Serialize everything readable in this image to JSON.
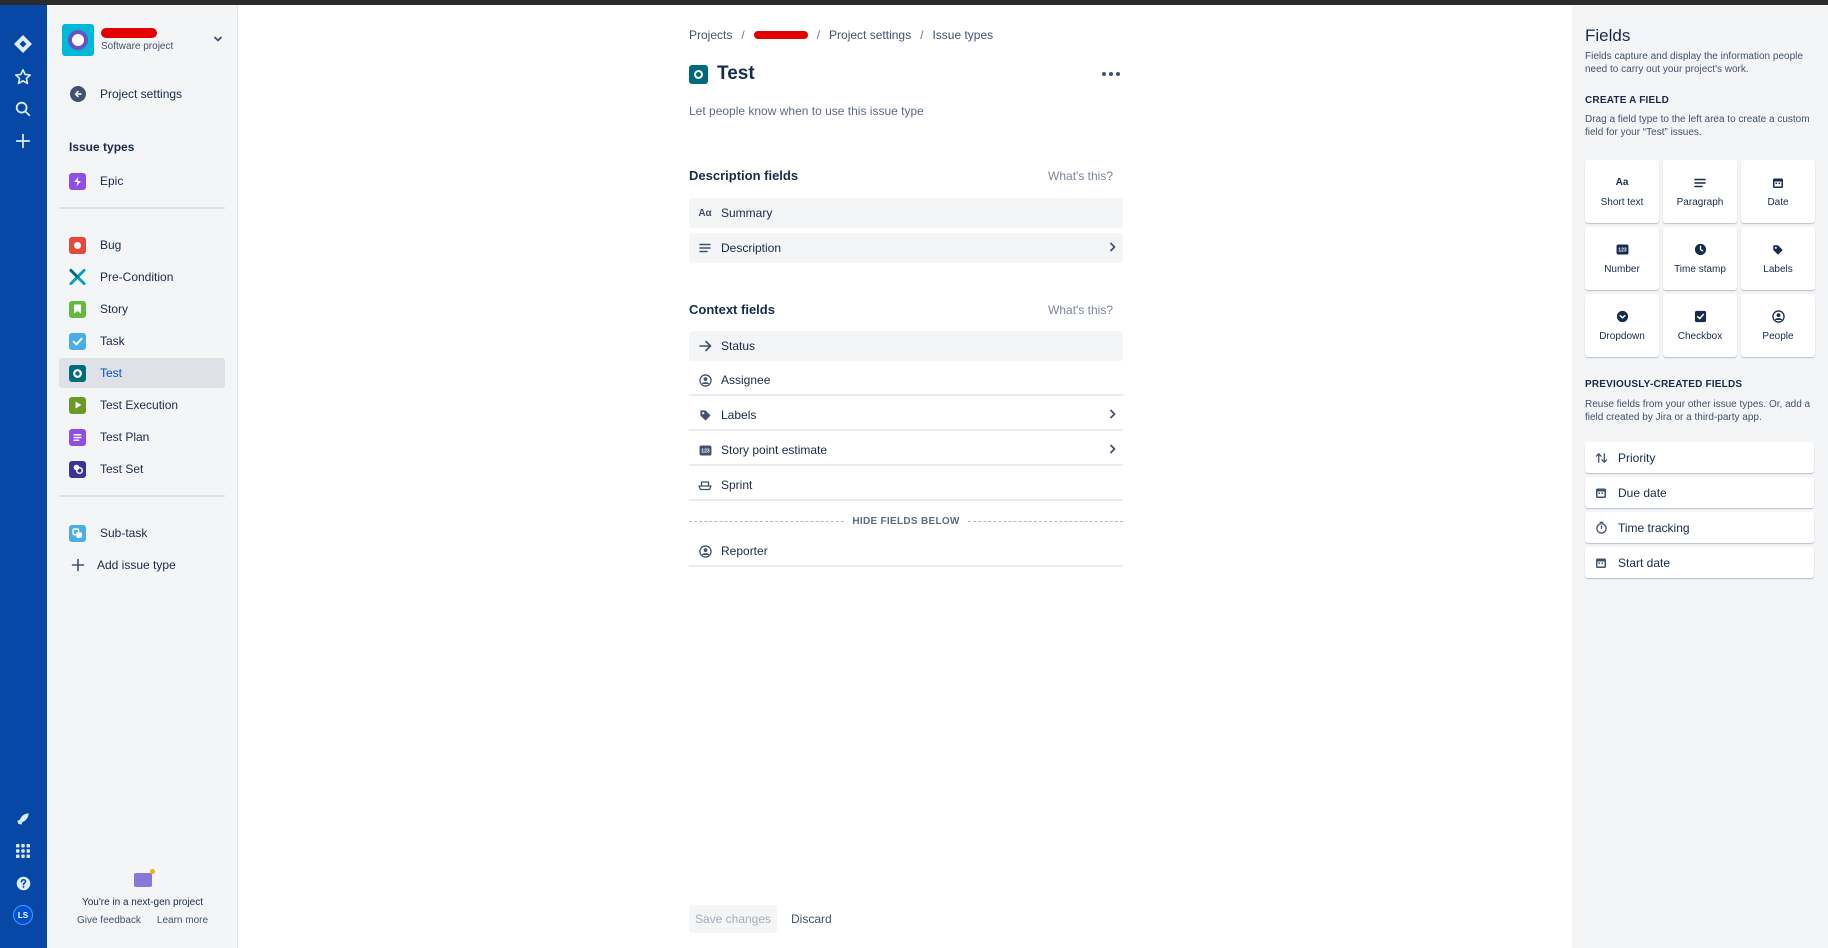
{
  "project": {
    "type_label": "Software project"
  },
  "sidebar": {
    "back_label": "Project settings",
    "section_title": "Issue types",
    "epic": {
      "label": "Epic",
      "color": "#904EE2"
    },
    "items": [
      {
        "label": "Bug",
        "color": "#E5493A"
      },
      {
        "label": "Pre-Condition",
        "color": "#00A3BF"
      },
      {
        "label": "Story",
        "color": "#63BA3C"
      },
      {
        "label": "Task",
        "color": "#4BADE8"
      },
      {
        "label": "Test",
        "color": "#006B7A"
      },
      {
        "label": "Test Execution",
        "color": "#6A9A23"
      },
      {
        "label": "Test Plan",
        "color": "#904EE2"
      },
      {
        "label": "Test Set",
        "color": "#403294"
      }
    ],
    "subtask": {
      "label": "Sub-task",
      "color": "#4BADE8"
    },
    "add_label": "Add issue type",
    "footer": {
      "text": "You're in a next-gen project",
      "feedback": "Give feedback",
      "learn": "Learn more"
    }
  },
  "main": {
    "breadcrumbs": {
      "projects": "Projects",
      "settings": "Project settings",
      "issue_types": "Issue types",
      "sep": "/"
    },
    "title": "Test",
    "description_placeholder": "Let people know when to use this issue type",
    "description_section": {
      "title": "Description fields",
      "whats_this": "What's this?",
      "fields": [
        {
          "label": "Summary",
          "icon": "text-icon"
        },
        {
          "label": "Description",
          "icon": "paragraph-icon"
        }
      ]
    },
    "context_section": {
      "title": "Context fields",
      "whats_this": "What's this?",
      "fields": [
        {
          "label": "Status",
          "icon": "arrow-right-icon"
        },
        {
          "label": "Assignee",
          "icon": "person-icon"
        },
        {
          "label": "Labels",
          "icon": "tag-icon"
        },
        {
          "label": "Story point estimate",
          "icon": "number-icon"
        },
        {
          "label": "Sprint",
          "icon": "sprint-icon"
        }
      ]
    },
    "hide_fields_label": "HIDE FIELDS BELOW",
    "hidden_fields": [
      {
        "label": "Reporter",
        "icon": "person-icon"
      }
    ],
    "save_label": "Save changes",
    "discard_label": "Discard"
  },
  "fields_panel": {
    "title": "Fields",
    "intro": "Fields capture and display the information people need to carry out your project's work.",
    "create_title": "CREATE A FIELD",
    "create_desc": "Drag a field type to the left area to create a custom field for your “Test” issues.",
    "types": [
      {
        "label": "Short text",
        "icon": "text-icon",
        "glyph": "Aa"
      },
      {
        "label": "Paragraph",
        "icon": "paragraph-icon"
      },
      {
        "label": "Date",
        "icon": "calendar-icon"
      },
      {
        "label": "Number",
        "icon": "number-icon",
        "glyph": "123"
      },
      {
        "label": "Time stamp",
        "icon": "clock-icon"
      },
      {
        "label": "Labels",
        "icon": "tag-icon"
      },
      {
        "label": "Dropdown",
        "icon": "dropdown-icon"
      },
      {
        "label": "Checkbox",
        "icon": "checkbox-icon"
      },
      {
        "label": "People",
        "icon": "person-icon"
      }
    ],
    "previous_title": "PREVIOUSLY-CREATED FIELDS",
    "previous_desc": "Reuse fields from your other issue types. Or, add a field created by Jira or a third-party app.",
    "previous": [
      {
        "label": "Priority",
        "icon": "priority-icon"
      },
      {
        "label": "Due date",
        "icon": "calendar-icon"
      },
      {
        "label": "Time tracking",
        "icon": "stopwatch-icon"
      },
      {
        "label": "Start date",
        "icon": "calendar-icon"
      }
    ]
  },
  "global_nav": {
    "user_initials": "LS"
  }
}
